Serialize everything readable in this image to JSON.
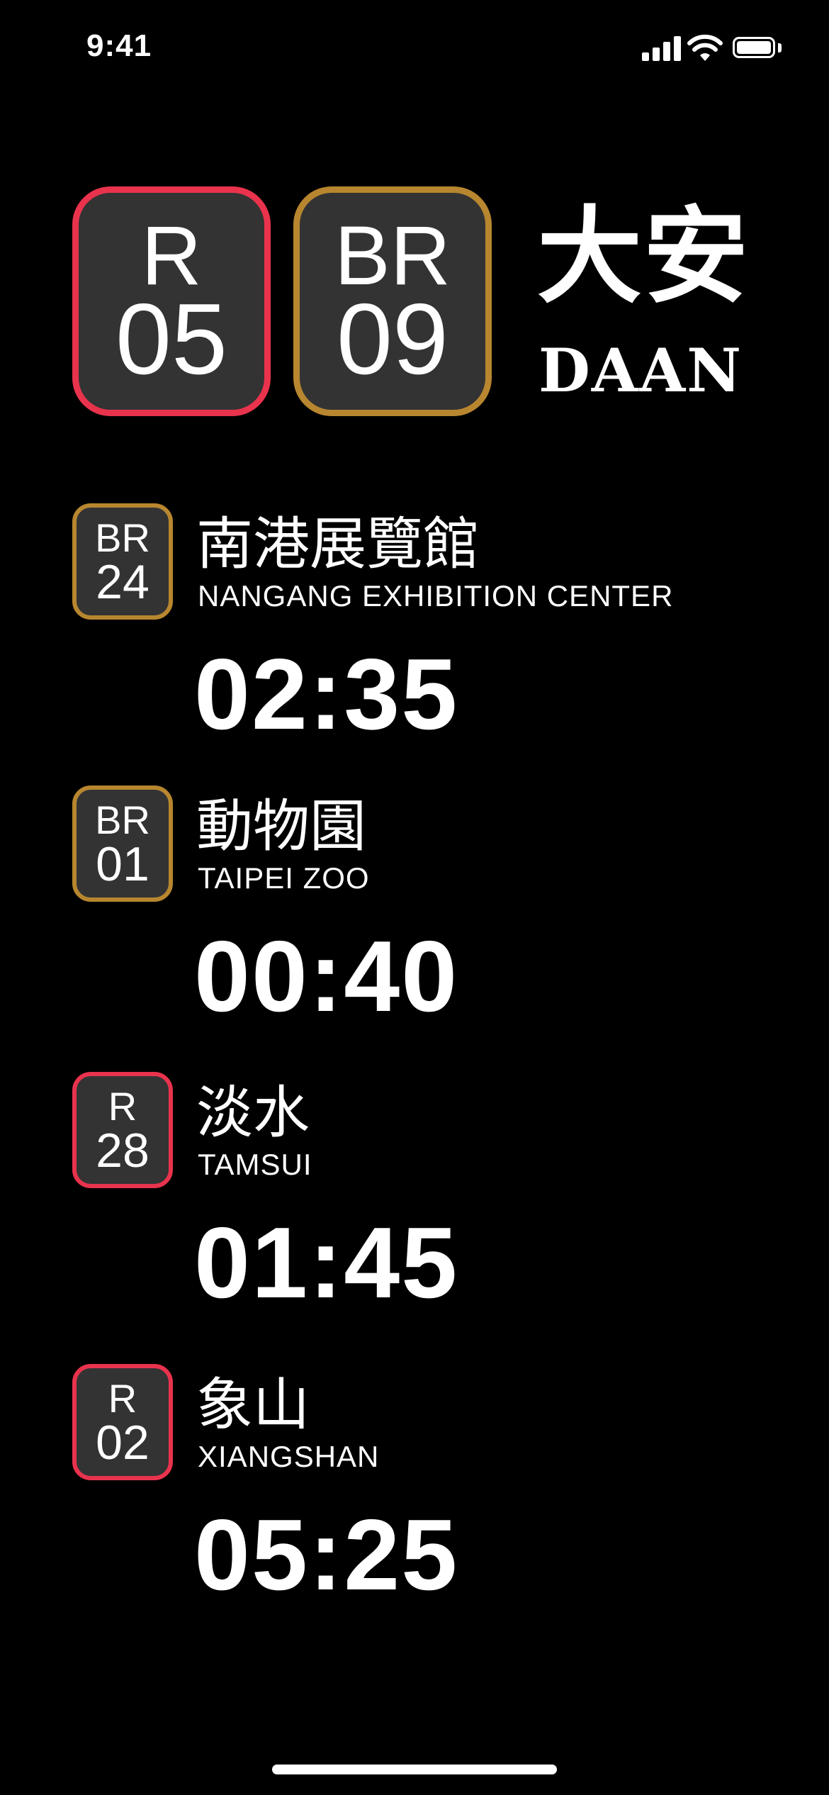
{
  "status_bar": {
    "time": "9:41"
  },
  "colors": {
    "red_line": "#E9334D",
    "brown_line": "#B7862F",
    "badge_bg": "#333333"
  },
  "station": {
    "badges": [
      {
        "line": "R",
        "number": "05",
        "color": "#E9334D"
      },
      {
        "line": "BR",
        "number": "09",
        "color": "#B7862F"
      }
    ],
    "name_zh": "大安",
    "name_en": "DAAN"
  },
  "departures": [
    {
      "line": "BR",
      "number": "24",
      "color": "#B7862F",
      "name_zh": "南港展覽館",
      "name_en": "NANGANG EXHIBITION CENTER",
      "countdown": "02:35"
    },
    {
      "line": "BR",
      "number": "01",
      "color": "#B7862F",
      "name_zh": "動物園",
      "name_en": "TAIPEI ZOO",
      "countdown": "00:40"
    },
    {
      "line": "R",
      "number": "28",
      "color": "#E9334D",
      "name_zh": "淡水",
      "name_en": "TAMSUI",
      "countdown": "01:45"
    },
    {
      "line": "R",
      "number": "02",
      "color": "#E9334D",
      "name_zh": "象山",
      "name_en": "XIANGSHAN",
      "countdown": "05:25"
    }
  ]
}
